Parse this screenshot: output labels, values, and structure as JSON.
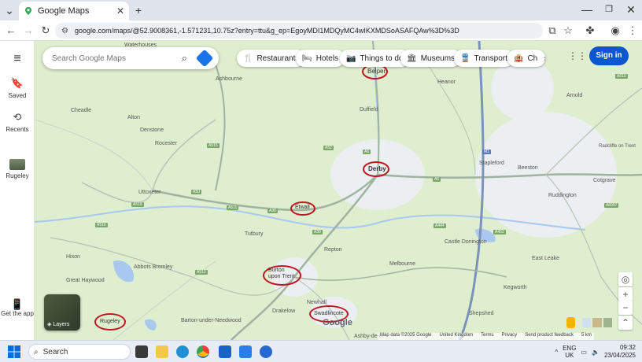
{
  "browser": {
    "tab_title": "Google Maps",
    "url": "google.com/maps/@52.9008361,-1.571231,10.75z?entry=ttu&g_ep=EgoyMDI1MDQyMC4wIKXMDSoASAFQAw%3D%3D",
    "new_tab": "+",
    "minimize": "—",
    "maximize": "❐",
    "close": "✕"
  },
  "rail": {
    "menu": "≡",
    "saved": "Saved",
    "recents": "Recents",
    "recent_place": "Rugeley",
    "get_app": "Get the app"
  },
  "search": {
    "placeholder": "Search Google Maps"
  },
  "chips": [
    {
      "icon": "🍴",
      "label": "Restaurants"
    },
    {
      "icon": "🛏",
      "label": "Hotels"
    },
    {
      "icon": "📷",
      "label": "Things to do"
    },
    {
      "icon": "🏛",
      "label": "Museums"
    },
    {
      "icon": "🚆",
      "label": "Transport"
    },
    {
      "icon": "🏨",
      "label": "Ch"
    }
  ],
  "signin": "Sign in",
  "places_small": [
    "Waterhouses",
    "Ashbourne",
    "Heanor",
    "Cheadle",
    "Alton",
    "Duffield",
    "Arnold",
    "Denstone",
    "Rocester",
    "Stapleford",
    "Beeston",
    "Uttoxeter",
    "Ruddington",
    "Radcliffe on Trent",
    "Cotgrave",
    "Tutbury",
    "Repton",
    "Castle Donington",
    "Melbourne",
    "Hixon",
    "Abbots Bromley",
    "Great Haywood",
    "Newhall",
    "Drakelow",
    "Barton-under-Needwood",
    "East Leake",
    "Shepshed",
    "Ashby-de-la",
    "Kegworth"
  ],
  "places_circled": [
    "Belper",
    "Derby",
    "Etwall",
    "Burton upon Trent",
    "Swadlincote",
    "Rugeley"
  ],
  "roads": [
    "A50",
    "A52",
    "A515",
    "A511",
    "A38",
    "A6",
    "A610",
    "A6097",
    "A453",
    "A6",
    "M1",
    "A38",
    "A516",
    "A512",
    "A444",
    "A518"
  ],
  "controls": {
    "locate": "◎",
    "zoom_in": "+",
    "zoom_out": "−",
    "layers": "Layers",
    "expand": "⌃"
  },
  "attribution": {
    "data": "Map data ©2025 Google",
    "country": "United Kingdom",
    "terms": "Terms",
    "privacy": "Privacy",
    "feedback": "Send product feedback",
    "scale": "5 km"
  },
  "google_logo": "Google",
  "taskbar": {
    "search": "Search",
    "lang": "ENG",
    "region": "UK",
    "time": "09:32",
    "date": "23/04/2025"
  }
}
